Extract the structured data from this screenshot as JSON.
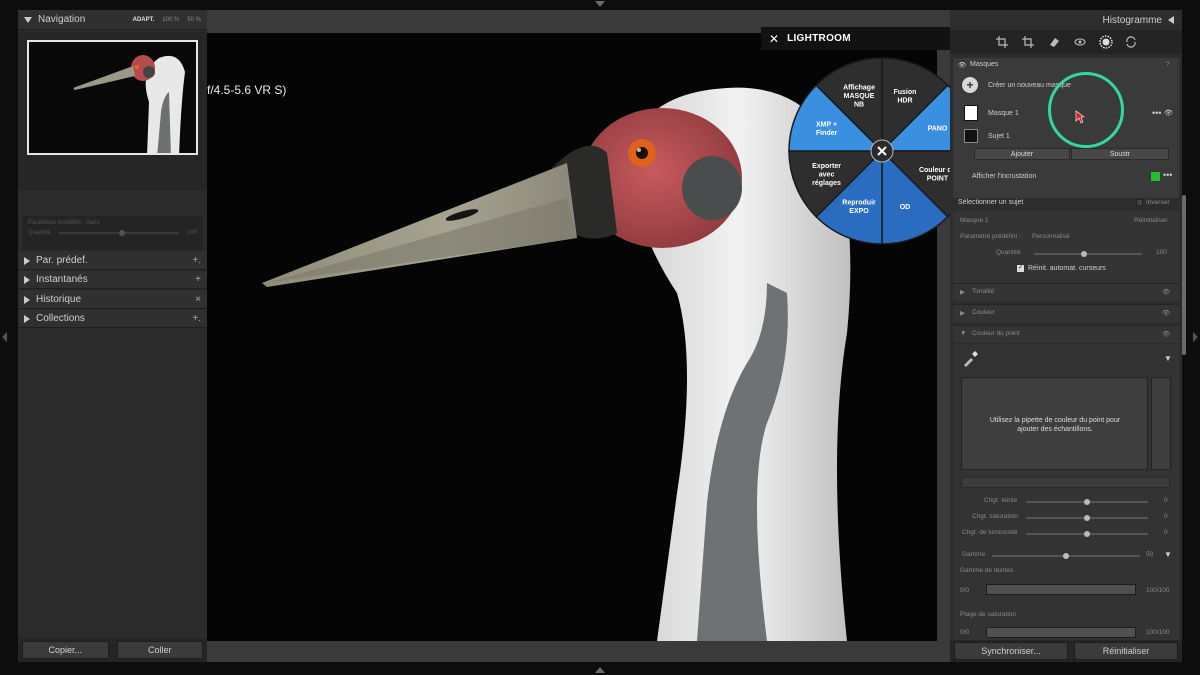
{
  "navigator": {
    "title": "Navigation",
    "zoom_adapt": "ADAPT.",
    "zoom_100": "100 %",
    "zoom_50": "50 %"
  },
  "preset_box": {
    "label": "Paramètre prédéfini : Sans",
    "amount_label": "Quantité",
    "amount_value": "100"
  },
  "left_sections": [
    {
      "label": "Par. prédef.",
      "action": "+."
    },
    {
      "label": "Instantanés",
      "action": "+"
    },
    {
      "label": "Historique",
      "action": "×"
    },
    {
      "label": "Collections",
      "action": "+."
    }
  ],
  "left_buttons": {
    "copy": "Copier...",
    "paste": "Coller"
  },
  "photo": {
    "lens_text": "f/4.5-5.6 VR S)"
  },
  "lr_bar": {
    "title": "LIGHTROOM"
  },
  "radial": {
    "center_icon": "close-icon",
    "slices": [
      {
        "lines": [
          "Fusion",
          "HDR"
        ],
        "color": "#2e2e2e"
      },
      {
        "lines": [
          "PANO"
        ],
        "color": "#3b8fe0"
      },
      {
        "lines": [
          "Couleur du",
          "POINT"
        ],
        "color": "#2e2e2e"
      },
      {
        "lines": [
          "OD"
        ],
        "color": "#2a6cc0"
      },
      {
        "lines": [
          "Reproduir",
          "EXPO"
        ],
        "color": "#2a6cc0"
      },
      {
        "lines": [
          "Exporter",
          "avec",
          "réglages"
        ],
        "color": "#2e2e2e"
      },
      {
        "lines": [
          "XMP +",
          "Finder"
        ],
        "color": "#3b8fe0"
      },
      {
        "lines": [
          "Affichage",
          "MASQUE",
          "NB"
        ],
        "color": "#2e2e2e"
      }
    ]
  },
  "right_panel": {
    "header": "Histogramme",
    "masques": "Masques",
    "create_mask": "Créer un nouveau masque",
    "mask1": "Masque 1",
    "subject1": "Sujet 1",
    "add": "Ajouter",
    "subtract": "Soustr",
    "overlay": "Afficher l'incrustation",
    "select_subject": "Sélectionner un sujet",
    "invert": "Inverser",
    "mask_name": "Masque 1",
    "reset": "Réinitialiser",
    "preset_label": "Paramètre prédéfini :",
    "preset_value": "Personnalisé",
    "amount_label": "Quantité",
    "amount_value": "100",
    "auto_reset": "Réinit. automat. curseurs",
    "sections": [
      "Tonalité",
      "Couleur",
      "Couleur du point"
    ],
    "eyedrop_hint": "Utilisez la pipette de couleur du point pour ajouter des échantillons.",
    "hue_shift": "Chgt. teinte",
    "sat_shift": "Chgt. saturation",
    "lum_shift": "Chgt. de luminosité",
    "slider_zero": "0",
    "range_label": "Gamme",
    "range_value": "50",
    "hue_range": "Gamme de teintes",
    "sat_range": "Plage de saturation",
    "range_min": "0/0",
    "range_max": "100/100",
    "overlay_color": "#22c02a"
  },
  "right_buttons": {
    "sync": "Synchroniser...",
    "reset": "Réinitialiser"
  },
  "cursor_ring_color": "#2fd9a0"
}
